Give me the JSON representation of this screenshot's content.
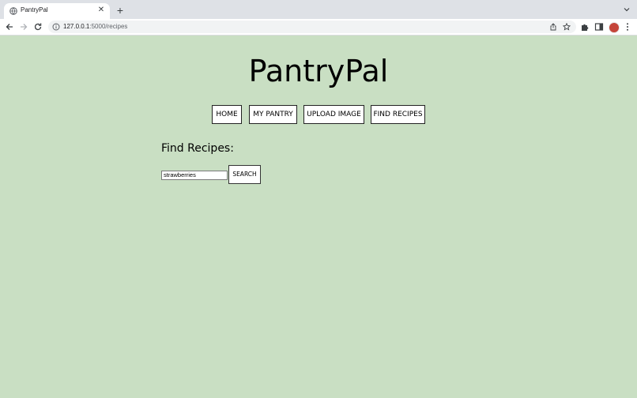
{
  "browser": {
    "tab_title": "PantryPal",
    "url_host": "127.0.0.1",
    "url_path": ":5000/recipes"
  },
  "site": {
    "title": "PantryPal"
  },
  "nav": {
    "items": [
      {
        "label": "HOME"
      },
      {
        "label": "MY PANTRY"
      },
      {
        "label": "UPLOAD IMAGE"
      },
      {
        "label": "FIND RECIPES"
      }
    ]
  },
  "recipes": {
    "heading": "Find Recipes:",
    "search_value": "strawberries",
    "search_button": "SEARCH"
  },
  "colors": {
    "page_background": "#c9dfc3",
    "avatar": "#c5453a"
  }
}
